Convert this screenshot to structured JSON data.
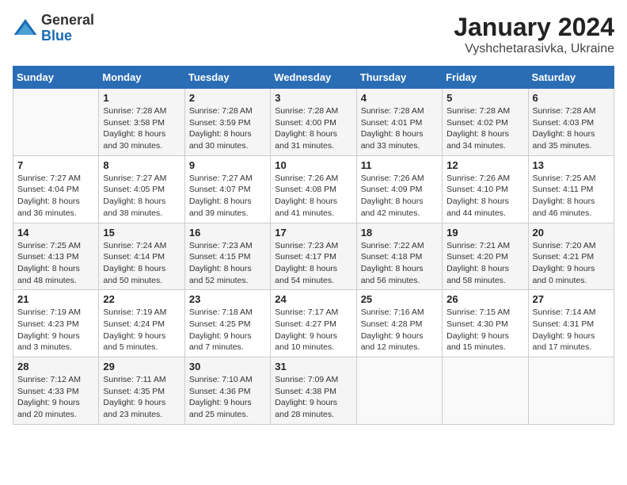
{
  "logo": {
    "general": "General",
    "blue": "Blue"
  },
  "title": "January 2024",
  "subtitle": "Vyshchetarasivka, Ukraine",
  "days_of_week": [
    "Sunday",
    "Monday",
    "Tuesday",
    "Wednesday",
    "Thursday",
    "Friday",
    "Saturday"
  ],
  "weeks": [
    [
      {
        "day": "",
        "info": ""
      },
      {
        "day": "1",
        "info": "Sunrise: 7:28 AM\nSunset: 3:58 PM\nDaylight: 8 hours\nand 30 minutes."
      },
      {
        "day": "2",
        "info": "Sunrise: 7:28 AM\nSunset: 3:59 PM\nDaylight: 8 hours\nand 30 minutes."
      },
      {
        "day": "3",
        "info": "Sunrise: 7:28 AM\nSunset: 4:00 PM\nDaylight: 8 hours\nand 31 minutes."
      },
      {
        "day": "4",
        "info": "Sunrise: 7:28 AM\nSunset: 4:01 PM\nDaylight: 8 hours\nand 33 minutes."
      },
      {
        "day": "5",
        "info": "Sunrise: 7:28 AM\nSunset: 4:02 PM\nDaylight: 8 hours\nand 34 minutes."
      },
      {
        "day": "6",
        "info": "Sunrise: 7:28 AM\nSunset: 4:03 PM\nDaylight: 8 hours\nand 35 minutes."
      }
    ],
    [
      {
        "day": "7",
        "info": "Sunrise: 7:27 AM\nSunset: 4:04 PM\nDaylight: 8 hours\nand 36 minutes."
      },
      {
        "day": "8",
        "info": "Sunrise: 7:27 AM\nSunset: 4:05 PM\nDaylight: 8 hours\nand 38 minutes."
      },
      {
        "day": "9",
        "info": "Sunrise: 7:27 AM\nSunset: 4:07 PM\nDaylight: 8 hours\nand 39 minutes."
      },
      {
        "day": "10",
        "info": "Sunrise: 7:26 AM\nSunset: 4:08 PM\nDaylight: 8 hours\nand 41 minutes."
      },
      {
        "day": "11",
        "info": "Sunrise: 7:26 AM\nSunset: 4:09 PM\nDaylight: 8 hours\nand 42 minutes."
      },
      {
        "day": "12",
        "info": "Sunrise: 7:26 AM\nSunset: 4:10 PM\nDaylight: 8 hours\nand 44 minutes."
      },
      {
        "day": "13",
        "info": "Sunrise: 7:25 AM\nSunset: 4:11 PM\nDaylight: 8 hours\nand 46 minutes."
      }
    ],
    [
      {
        "day": "14",
        "info": "Sunrise: 7:25 AM\nSunset: 4:13 PM\nDaylight: 8 hours\nand 48 minutes."
      },
      {
        "day": "15",
        "info": "Sunrise: 7:24 AM\nSunset: 4:14 PM\nDaylight: 8 hours\nand 50 minutes."
      },
      {
        "day": "16",
        "info": "Sunrise: 7:23 AM\nSunset: 4:15 PM\nDaylight: 8 hours\nand 52 minutes."
      },
      {
        "day": "17",
        "info": "Sunrise: 7:23 AM\nSunset: 4:17 PM\nDaylight: 8 hours\nand 54 minutes."
      },
      {
        "day": "18",
        "info": "Sunrise: 7:22 AM\nSunset: 4:18 PM\nDaylight: 8 hours\nand 56 minutes."
      },
      {
        "day": "19",
        "info": "Sunrise: 7:21 AM\nSunset: 4:20 PM\nDaylight: 8 hours\nand 58 minutes."
      },
      {
        "day": "20",
        "info": "Sunrise: 7:20 AM\nSunset: 4:21 PM\nDaylight: 9 hours\nand 0 minutes."
      }
    ],
    [
      {
        "day": "21",
        "info": "Sunrise: 7:19 AM\nSunset: 4:23 PM\nDaylight: 9 hours\nand 3 minutes."
      },
      {
        "day": "22",
        "info": "Sunrise: 7:19 AM\nSunset: 4:24 PM\nDaylight: 9 hours\nand 5 minutes."
      },
      {
        "day": "23",
        "info": "Sunrise: 7:18 AM\nSunset: 4:25 PM\nDaylight: 9 hours\nand 7 minutes."
      },
      {
        "day": "24",
        "info": "Sunrise: 7:17 AM\nSunset: 4:27 PM\nDaylight: 9 hours\nand 10 minutes."
      },
      {
        "day": "25",
        "info": "Sunrise: 7:16 AM\nSunset: 4:28 PM\nDaylight: 9 hours\nand 12 minutes."
      },
      {
        "day": "26",
        "info": "Sunrise: 7:15 AM\nSunset: 4:30 PM\nDaylight: 9 hours\nand 15 minutes."
      },
      {
        "day": "27",
        "info": "Sunrise: 7:14 AM\nSunset: 4:31 PM\nDaylight: 9 hours\nand 17 minutes."
      }
    ],
    [
      {
        "day": "28",
        "info": "Sunrise: 7:12 AM\nSunset: 4:33 PM\nDaylight: 9 hours\nand 20 minutes."
      },
      {
        "day": "29",
        "info": "Sunrise: 7:11 AM\nSunset: 4:35 PM\nDaylight: 9 hours\nand 23 minutes."
      },
      {
        "day": "30",
        "info": "Sunrise: 7:10 AM\nSunset: 4:36 PM\nDaylight: 9 hours\nand 25 minutes."
      },
      {
        "day": "31",
        "info": "Sunrise: 7:09 AM\nSunset: 4:38 PM\nDaylight: 9 hours\nand 28 minutes."
      },
      {
        "day": "",
        "info": ""
      },
      {
        "day": "",
        "info": ""
      },
      {
        "day": "",
        "info": ""
      }
    ]
  ]
}
